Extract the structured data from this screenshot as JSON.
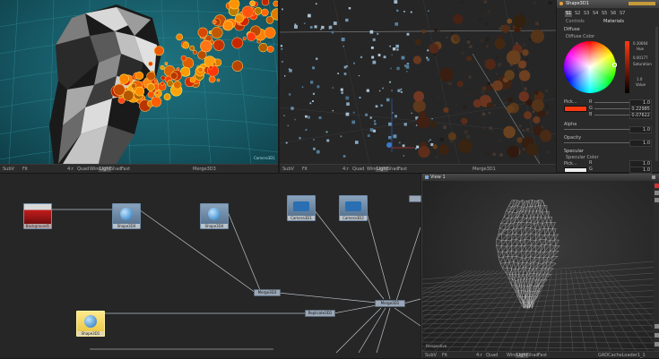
{
  "viewport_top_left": {
    "label": "Camera3D1",
    "toolbar": [
      "SubV",
      "Fit",
      "",
      "",
      "",
      "4:r",
      "Quad",
      "Wire",
      "Light",
      "Shad",
      "Fast"
    ],
    "center_label": "Merge3D3"
  },
  "viewport_top_mid": {
    "label": "",
    "toolbar": [
      "SubV",
      "Fit",
      "",
      "",
      "",
      "4:r",
      "Quad",
      "Wire",
      "Light",
      "Shad",
      "Fast"
    ],
    "center_label": "Merge3D1"
  },
  "inspector": {
    "title": "Shape3D1",
    "tabs": [
      "S1",
      "S2",
      "S3",
      "S4",
      "S5",
      "S6",
      "S7"
    ],
    "subtabs": [
      "Controls",
      "Materials"
    ],
    "sections": {
      "diffuse": "Diffuse",
      "diffuse_color": "Diffuse Color",
      "specular": "Specular",
      "specular_color": "Specular Color"
    },
    "picker_values": {
      "hue": "0.30664",
      "hue_label": "Hue",
      "sat": "0.00177",
      "sat_label": "Saturation",
      "val": "1.0",
      "val_label": "Value"
    },
    "pick_label": "Pick...",
    "channels": [
      {
        "label": "R",
        "value": "1.0"
      },
      {
        "label": "G",
        "value": "0.22985"
      },
      {
        "label": "B",
        "value": "0.07622"
      }
    ],
    "alpha_label": "Alpha",
    "alpha_value": "1.0",
    "opacity_label": "Opacity",
    "opacity_value": "1.0",
    "spec_pick": "Pick...",
    "spec_r": "1.0",
    "spec_g": "1.0",
    "spec_r_label": "R",
    "spec_g_label": "G",
    "accent": "#e8a23a",
    "swatch_color": "#ff3a12"
  },
  "flow": {
    "nodes": [
      {
        "name": "Background1"
      },
      {
        "name": "Shape3D4"
      },
      {
        "name": "Shape3D4"
      },
      {
        "name": "Camera3D1"
      },
      {
        "name": "Camera3D2"
      },
      {
        "name": "Shape3D1"
      }
    ],
    "pipes": [
      "Merge3D3",
      "Replicate3D1",
      "Merge3D1",
      ""
    ]
  },
  "view1": {
    "title": "View 1",
    "label": "Perspective",
    "toolbar": [
      "SubV",
      "Fit",
      "",
      "",
      "",
      "4:r",
      "Quad",
      "Wire",
      "Light",
      "Shad",
      "Fast"
    ],
    "center_label": "GADCacheLoader1_1"
  },
  "colors": {
    "viewport_bg": "#165a66",
    "accent_orange": "#ff5a1a"
  }
}
